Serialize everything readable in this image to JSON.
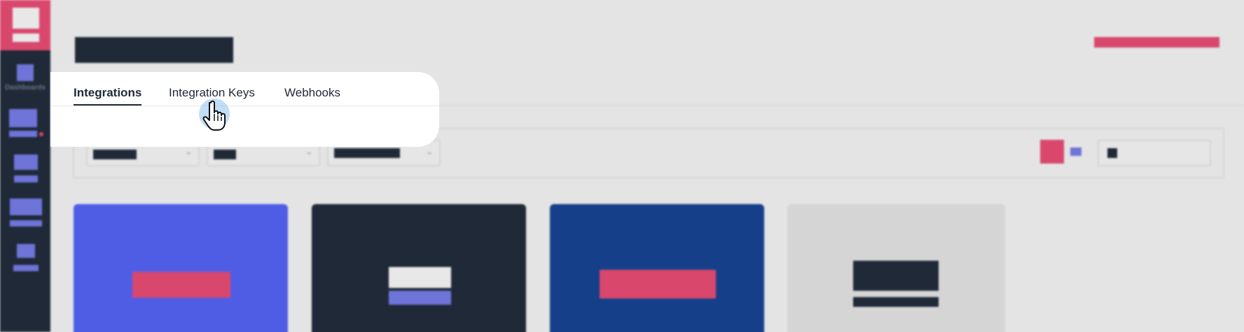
{
  "sidebar": {
    "items": [
      {
        "label": "Dashboards",
        "icon": "dashboard-icon"
      },
      {
        "label": "",
        "icon": "integrations-icon",
        "badge": true
      },
      {
        "label": "",
        "icon": "reports-icon"
      },
      {
        "label": "",
        "icon": "monitors-icon"
      },
      {
        "label": "",
        "icon": "settings-icon"
      }
    ]
  },
  "tabs": [
    {
      "label": "Integrations",
      "active": true
    },
    {
      "label": "Integration Keys",
      "active": false
    },
    {
      "label": "Webhooks",
      "active": false
    }
  ],
  "filters": {
    "selects": [
      {
        "chevron": "⌄"
      },
      {
        "chevron": "⌄"
      },
      {
        "chevron": "⌄"
      }
    ]
  },
  "colors": {
    "brand_pink": "#d9476c",
    "sidebar_dark": "#1f2937",
    "accent_purple": "#6f74d9",
    "card_indigo": "#4f5de5",
    "card_dark": "#1f2937",
    "card_blue": "#163f8a",
    "card_gray": "#d5d5d5"
  }
}
